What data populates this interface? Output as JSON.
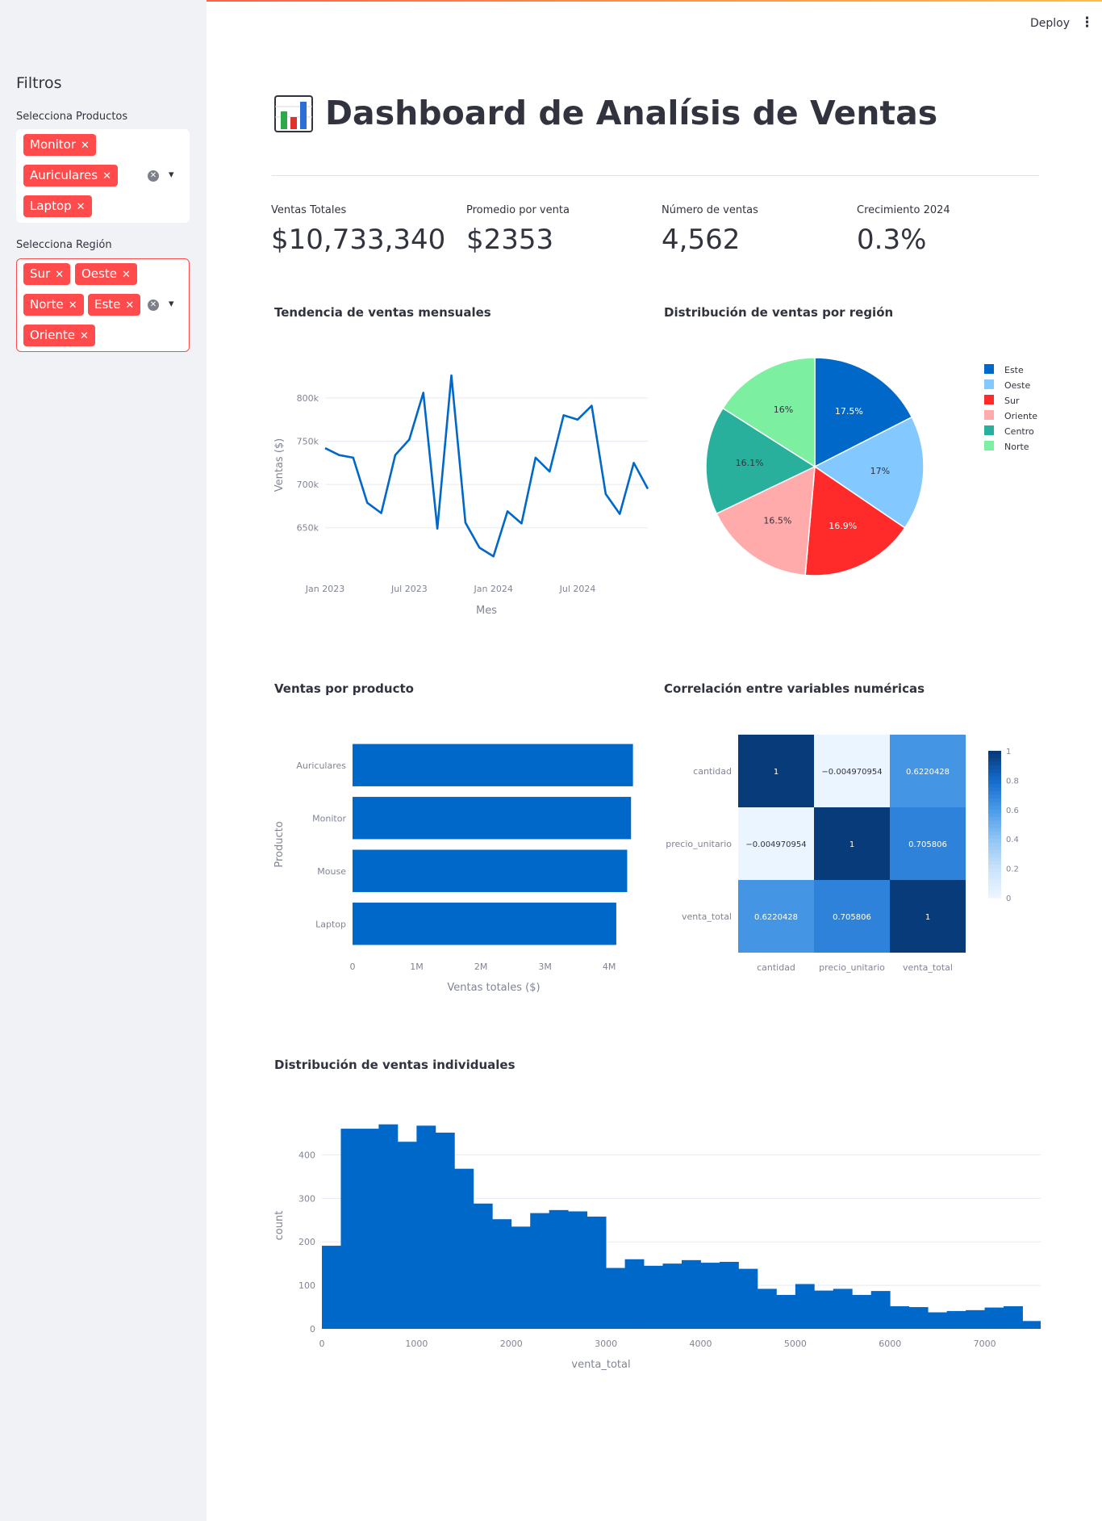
{
  "header": {
    "deploy_label": "Deploy",
    "menu_icon": "kebab-icon"
  },
  "sidebar": {
    "title": "Filtros",
    "products": {
      "label": "Selecciona Productos",
      "selected": [
        "Monitor",
        "Auriculares",
        "Laptop"
      ]
    },
    "regions": {
      "label": "Selecciona Región",
      "selected": [
        "Sur",
        "Oeste",
        "Norte",
        "Este",
        "Oriente"
      ]
    }
  },
  "main": {
    "title": "Dashboard de Analísis de Ventas",
    "title_icon": "bar-chart-icon",
    "metrics": [
      {
        "label": "Ventas Totales",
        "value": "$10,733,340"
      },
      {
        "label": "Promedio por venta",
        "value": "$2353"
      },
      {
        "label": "Número de ventas",
        "value": "4,562"
      },
      {
        "label": "Crecimiento 2024",
        "value": "0.3%"
      }
    ]
  },
  "colors": {
    "accent": "#ff4b4b",
    "plot_blue": "#0068c9"
  },
  "chart_data": [
    {
      "type": "line",
      "title": "Tendencia de ventas mensuales",
      "xlabel": "Mes",
      "ylabel": "Ventas ($)",
      "x": [
        "2023-01",
        "2023-02",
        "2023-03",
        "2023-04",
        "2023-05",
        "2023-06",
        "2023-07",
        "2023-08",
        "2023-09",
        "2023-10",
        "2023-11",
        "2023-12",
        "2024-01",
        "2024-02",
        "2024-03",
        "2024-04",
        "2024-05",
        "2024-06",
        "2024-07",
        "2024-08",
        "2024-09",
        "2024-10",
        "2024-11",
        "2024-12"
      ],
      "x_tick_labels": [
        "Jan 2023",
        "Jul 2023",
        "Jan 2024",
        "Jul 2024"
      ],
      "y": [
        742000,
        734000,
        731000,
        679000,
        667000,
        734000,
        752000,
        806000,
        649000,
        826000,
        656000,
        627000,
        617000,
        669000,
        655000,
        731000,
        715000,
        780000,
        775000,
        791000,
        689000,
        666000,
        725000,
        695000
      ],
      "y_ticks": [
        "650k",
        "700k",
        "750k",
        "800k"
      ],
      "ylim": [
        605000,
        840000
      ],
      "grid": true
    },
    {
      "type": "pie",
      "title": "Distribución de ventas por región",
      "labels": [
        "Este",
        "Oeste",
        "Sur",
        "Oriente",
        "Centro",
        "Norte"
      ],
      "values": [
        17.5,
        17.0,
        16.9,
        16.5,
        16.1,
        16.0
      ],
      "value_labels": [
        "17.5%",
        "17%",
        "16.9%",
        "16.5%",
        "16.1%",
        "16%"
      ],
      "colors": [
        "#0068c9",
        "#83c9ff",
        "#ff2b2b",
        "#ffabab",
        "#29b09d",
        "#7defa1"
      ],
      "legend": "right"
    },
    {
      "type": "bar",
      "title": "Ventas por producto",
      "orientation": "horizontal",
      "categories": [
        "Auriculares",
        "Monitor",
        "Mouse",
        "Laptop"
      ],
      "values": [
        4370000,
        4340000,
        4280000,
        4110000
      ],
      "xlabel": "Ventas totales ($)",
      "ylabel": "Producto",
      "x_ticks": [
        "0",
        "1M",
        "2M",
        "3M",
        "4M"
      ],
      "xlim": [
        0,
        4400000
      ],
      "grid": false
    },
    {
      "type": "heatmap",
      "title": "Correlación entre variables numéricas",
      "x": [
        "cantidad",
        "precio_unitario",
        "venta_total"
      ],
      "y": [
        "cantidad",
        "precio_unitario",
        "venta_total"
      ],
      "z": [
        [
          1,
          -0.004970954,
          0.6220428
        ],
        [
          -0.004970954,
          1,
          0.705806
        ],
        [
          0.6220428,
          0.705806,
          1
        ]
      ],
      "z_labels": [
        [
          "1",
          "−0.004970954",
          "0.6220428"
        ],
        [
          "−0.004970954",
          "1",
          "0.705806"
        ],
        [
          "0.6220428",
          "0.705806",
          "1"
        ]
      ],
      "colorbar_ticks": [
        "0",
        "0.2",
        "0.4",
        "0.6",
        "0.8",
        "1"
      ]
    },
    {
      "type": "bar",
      "subtype": "histogram",
      "title": "Distribución de ventas individuales",
      "xlabel": "venta_total",
      "ylabel": "count",
      "bin_width": 200,
      "x_start": 0,
      "values": [
        191,
        460,
        460,
        470,
        430,
        467,
        451,
        368,
        288,
        252,
        235,
        266,
        273,
        270,
        258,
        140,
        160,
        145,
        150,
        158,
        152,
        154,
        138,
        92,
        78,
        103,
        88,
        92,
        78,
        87,
        52,
        50,
        38,
        41,
        43,
        49,
        52,
        18
      ],
      "x_ticks": [
        "0",
        "1000",
        "2000",
        "3000",
        "4000",
        "5000",
        "6000",
        "7000"
      ],
      "y_ticks": [
        "0",
        "100",
        "200",
        "300",
        "400"
      ],
      "xlim": [
        0,
        7600
      ],
      "ylim": [
        0,
        475
      ],
      "grid": true
    }
  ]
}
